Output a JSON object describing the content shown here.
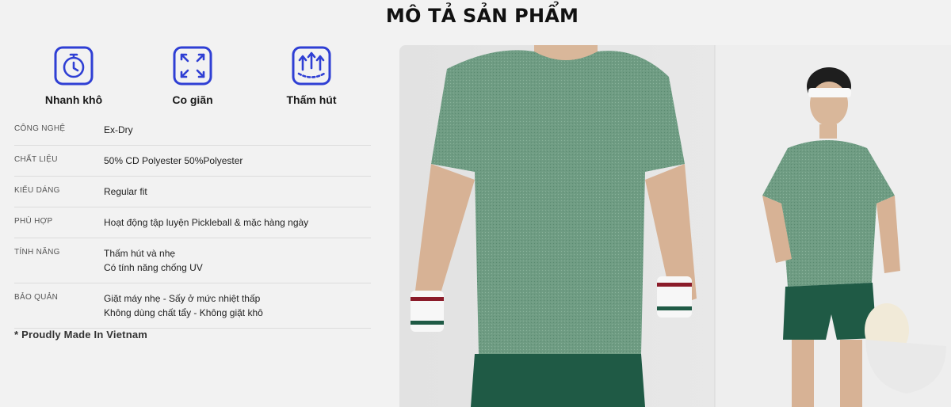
{
  "page": {
    "title": "MÔ TẢ SẢN PHẨM"
  },
  "features": [
    {
      "icon": "stopwatch-icon",
      "label": "Nhanh khô"
    },
    {
      "icon": "expand-arrows-icon",
      "label": "Co giãn"
    },
    {
      "icon": "upload-arrows-icon",
      "label": "Thấm hút"
    }
  ],
  "specs": [
    {
      "key": "CÔNG NGHỆ",
      "values": [
        "Ex-Dry"
      ]
    },
    {
      "key": "CHẤT LIỆU",
      "values": [
        "50% CD Polyester 50%Polyester"
      ]
    },
    {
      "key": "KIỂU DÁNG",
      "values": [
        "Regular fit"
      ]
    },
    {
      "key": "PHÙ HỢP",
      "values": [
        "Hoạt động tập luyện Pickleball & mặc hàng ngày"
      ]
    },
    {
      "key": "TÍNH NĂNG",
      "values": [
        "Thấm hút và nhẹ",
        "Có tính năng chống UV"
      ]
    },
    {
      "key": "BẢO QUẢN",
      "values": [
        "Giặt máy nhẹ - Sấy ở mức nhiệt thấp",
        "Không dùng chất tẩy - Không giặt khô"
      ]
    }
  ],
  "footnote": "* Proudly Made In Vietnam",
  "colors": {
    "icon_blue": "#2f3fd4",
    "shirt_green": "#6c9a80",
    "shorts_green": "#1f5a45",
    "background": "#f2f2f2"
  }
}
